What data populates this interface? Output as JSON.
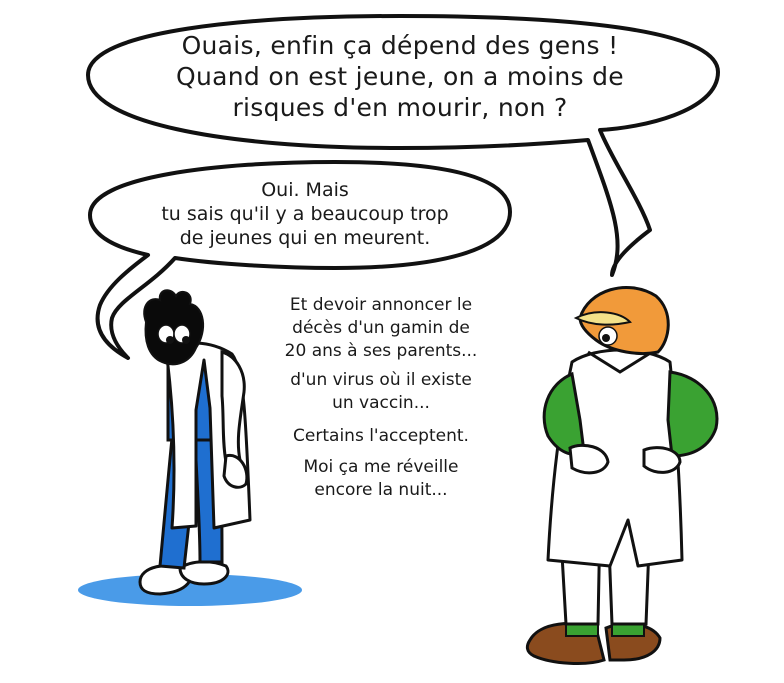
{
  "bubble_top": {
    "lines": [
      "Ouais, enfin ça dépend des gens !",
      "Quand on est jeune, on a moins de",
      "risques d'en mourir, non ?"
    ]
  },
  "bubble_left": {
    "lines": [
      "Oui. Mais",
      "tu sais qu'il y a beaucoup trop",
      "de jeunes qui en meurent."
    ]
  },
  "narration": {
    "block1": [
      "Et devoir annoncer le",
      "décès d'un gamin de",
      "20 ans à ses parents..."
    ],
    "block2": [
      "d'un virus où il existe",
      "un vaccin..."
    ],
    "block3": [
      "Certains l'acceptent."
    ],
    "block4": [
      "Moi ça me réveille",
      "encore la nuit..."
    ]
  },
  "colors": {
    "outline": "#111111",
    "coat": "#ffffff",
    "jeans": "#1f6fd0",
    "shadow": "#4a9be8",
    "hair": "#0a0a0a",
    "cap": "#f19a3a",
    "sleeve": "#3aa232",
    "shoe": "#8a4b1e"
  }
}
